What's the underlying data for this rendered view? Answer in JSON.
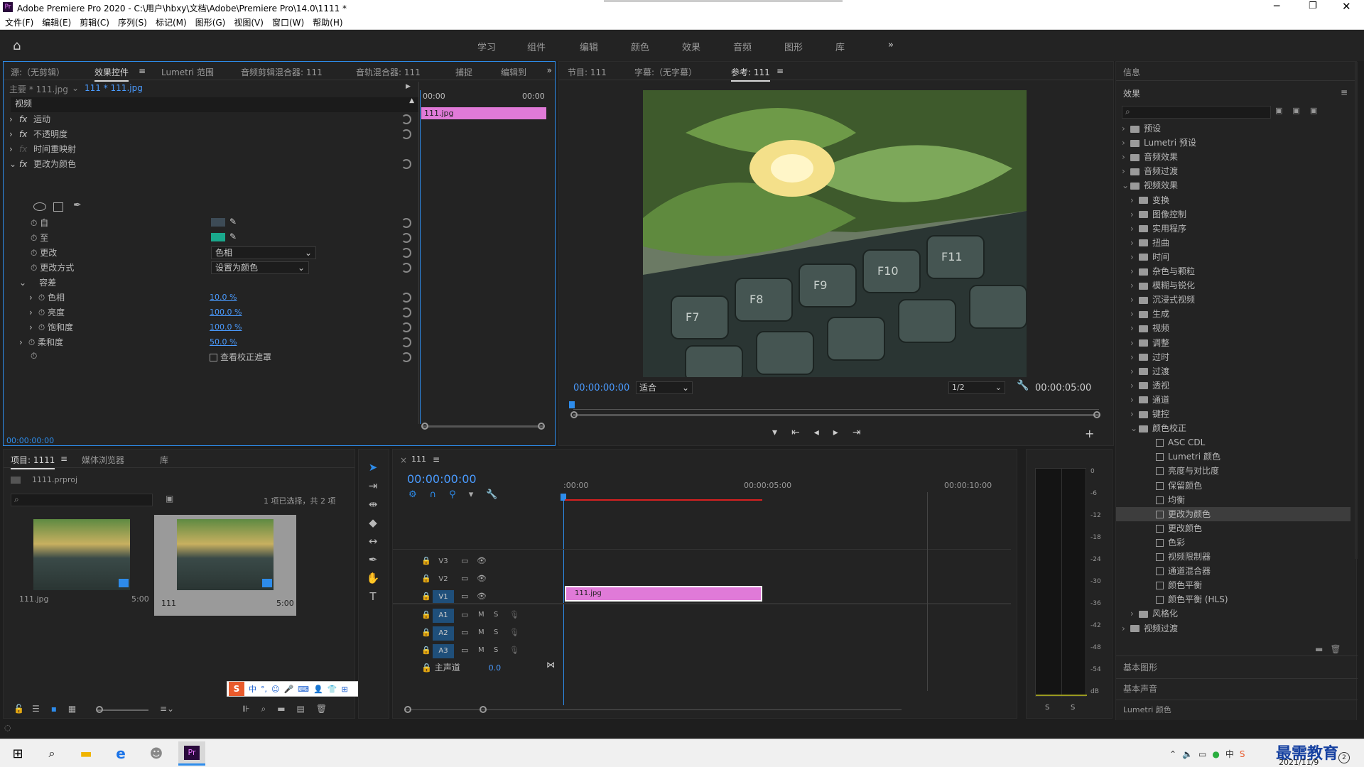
{
  "title": "Adobe Premiere Pro 2020 - C:\\用户\\hbxy\\文档\\Adobe\\Premiere Pro\\14.0\\1111 *",
  "menu": [
    "文件(F)",
    "编辑(E)",
    "剪辑(C)",
    "序列(S)",
    "标记(M)",
    "图形(G)",
    "视图(V)",
    "窗口(W)",
    "帮助(H)"
  ],
  "workspaces": [
    "学习",
    "组件",
    "编辑",
    "颜色",
    "效果",
    "音频",
    "图形",
    "库"
  ],
  "workspace_more": "»",
  "source_tabs": [
    "源:（无剪辑）",
    "效果控件",
    "Lumetri 范围",
    "音频剪辑混合器: 111",
    "音轨混合器: 111",
    "捕捉",
    "编辑到"
  ],
  "effect_controls": {
    "master": "主要 * 111.jpg",
    "clip": "111 * 111.jpg",
    "time_start": "00:00",
    "time_end": "00:00",
    "clip_bar_label": "111.jpg",
    "section": "视频",
    "rows": [
      {
        "label": "运动",
        "fx": true
      },
      {
        "label": "不透明度",
        "fx": true
      },
      {
        "label": "时间重映射",
        "fx": false
      },
      {
        "label": "更改为颜色",
        "fx": true
      }
    ],
    "from_label": "自",
    "to_label": "至",
    "change_label": "更改",
    "change_value": "色相",
    "change_by_label": "更改方式",
    "change_by_value": "设置为颜色",
    "tolerance_label": "容差",
    "hue_label": "色相",
    "hue_value": "10.0 %",
    "lightness_label": "亮度",
    "lightness_value": "100.0 %",
    "saturation_label": "饱和度",
    "saturation_value": "100.0 %",
    "softness_label": "柔和度",
    "softness_value": "50.0 %",
    "view_mask_label": "查看校正遮罩",
    "timecode": "00:00:00:00",
    "from_color": "#3d4b56",
    "to_color": "#1aa88c"
  },
  "program_tabs": [
    "节目: 111",
    "字幕:（无字幕）",
    "参考: 111"
  ],
  "program": {
    "timecode": "00:00:00:00",
    "fit": "适合",
    "res": "1/2",
    "duration": "00:00:05:00",
    "keys": [
      "F7",
      "F8",
      "F9",
      "F10",
      "F11"
    ]
  },
  "right_panel": {
    "info": "信息",
    "effects": "效果",
    "search_placeholder": "",
    "tree": [
      {
        "label": "预设",
        "depth": 0,
        "type": "folder",
        "open": false
      },
      {
        "label": "Lumetri 预设",
        "depth": 0,
        "type": "folder",
        "open": false
      },
      {
        "label": "音频效果",
        "depth": 0,
        "type": "folder",
        "open": false
      },
      {
        "label": "音频过渡",
        "depth": 0,
        "type": "folder",
        "open": false
      },
      {
        "label": "视频效果",
        "depth": 0,
        "type": "folder",
        "open": true
      },
      {
        "label": "变换",
        "depth": 1,
        "type": "folder",
        "open": false
      },
      {
        "label": "图像控制",
        "depth": 1,
        "type": "folder",
        "open": false
      },
      {
        "label": "实用程序",
        "depth": 1,
        "type": "folder",
        "open": false
      },
      {
        "label": "扭曲",
        "depth": 1,
        "type": "folder",
        "open": false
      },
      {
        "label": "时间",
        "depth": 1,
        "type": "folder",
        "open": false
      },
      {
        "label": "杂色与颗粒",
        "depth": 1,
        "type": "folder",
        "open": false
      },
      {
        "label": "模糊与锐化",
        "depth": 1,
        "type": "folder",
        "open": false
      },
      {
        "label": "沉浸式视频",
        "depth": 1,
        "type": "folder",
        "open": false
      },
      {
        "label": "生成",
        "depth": 1,
        "type": "folder",
        "open": false
      },
      {
        "label": "视频",
        "depth": 1,
        "type": "folder",
        "open": false
      },
      {
        "label": "调整",
        "depth": 1,
        "type": "folder",
        "open": false
      },
      {
        "label": "过时",
        "depth": 1,
        "type": "folder",
        "open": false
      },
      {
        "label": "过渡",
        "depth": 1,
        "type": "folder",
        "open": false
      },
      {
        "label": "透视",
        "depth": 1,
        "type": "folder",
        "open": false
      },
      {
        "label": "通道",
        "depth": 1,
        "type": "folder",
        "open": false
      },
      {
        "label": "键控",
        "depth": 1,
        "type": "folder",
        "open": false
      },
      {
        "label": "颜色校正",
        "depth": 1,
        "type": "folder",
        "open": true
      },
      {
        "label": "ASC CDL",
        "depth": 2,
        "type": "effect"
      },
      {
        "label": "Lumetri 颜色",
        "depth": 2,
        "type": "effect"
      },
      {
        "label": "亮度与对比度",
        "depth": 2,
        "type": "effect"
      },
      {
        "label": "保留颜色",
        "depth": 2,
        "type": "effect"
      },
      {
        "label": "均衡",
        "depth": 2,
        "type": "effect"
      },
      {
        "label": "更改为颜色",
        "depth": 2,
        "type": "effect",
        "selected": true
      },
      {
        "label": "更改颜色",
        "depth": 2,
        "type": "effect"
      },
      {
        "label": "色彩",
        "depth": 2,
        "type": "effect"
      },
      {
        "label": "视频限制器",
        "depth": 2,
        "type": "effect"
      },
      {
        "label": "通道混合器",
        "depth": 2,
        "type": "effect"
      },
      {
        "label": "颜色平衡",
        "depth": 2,
        "type": "effect"
      },
      {
        "label": "颜色平衡 (HLS)",
        "depth": 2,
        "type": "effect"
      },
      {
        "label": "风格化",
        "depth": 1,
        "type": "folder",
        "open": false
      },
      {
        "label": "视频过渡",
        "depth": 0,
        "type": "folder",
        "open": false
      }
    ],
    "basic_graphics": "基本图形",
    "basic_sound": "基本声音",
    "lumetri_color": "Lumetri 颜色"
  },
  "project": {
    "tabs": [
      "项目: 1111",
      "媒体浏览器",
      "库"
    ],
    "file": "1111.prproj",
    "selection": "1 项已选择，共 2 项",
    "items": [
      {
        "name": "111.jpg",
        "dur": "5:00"
      },
      {
        "name": "111",
        "dur": "5:00"
      }
    ]
  },
  "ime": [
    "中",
    "°,",
    "☺",
    "🎤",
    "⌨",
    "👤",
    "👕",
    "⊞"
  ],
  "timeline": {
    "tab": "111",
    "timecode": "00:00:00:00",
    "ruler": [
      ":00:00",
      "00:00:05:00",
      "00:00:10:00"
    ],
    "video_tracks": [
      "V3",
      "V2",
      "V1"
    ],
    "audio_tracks": [
      "A1",
      "A2",
      "A3"
    ],
    "master": "主声道",
    "master_val": "0.0",
    "clip": "111.jpg"
  },
  "meter": {
    "scale": [
      "0",
      "-6",
      "-12",
      "-18",
      "-24",
      "-30",
      "-36",
      "-42",
      "-48",
      "-54",
      "dB"
    ],
    "s": [
      "S",
      "S"
    ]
  },
  "taskbar": {
    "date": "2021/11/9",
    "watermark": "最需教育"
  },
  "colors": {
    "accent": "#2d8ceb",
    "clip": "#e07ad8",
    "selected": "#3d3d3d"
  }
}
